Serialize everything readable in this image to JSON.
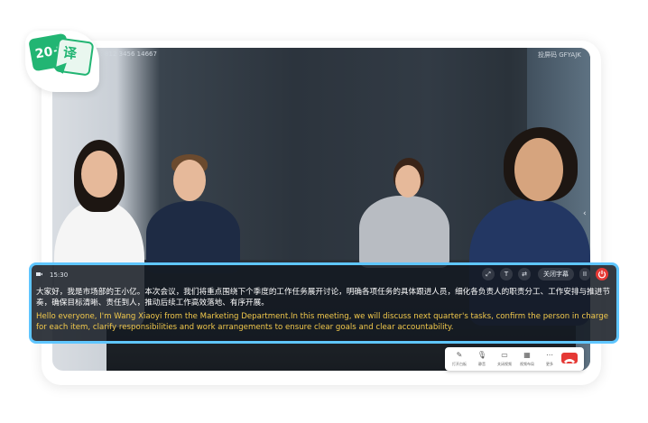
{
  "app": {
    "badge_count": "20+",
    "badge_char": "译",
    "badge_color": "#22b573"
  },
  "meeting": {
    "id_text": "ID: 812 3456 14667",
    "share_code_text": "投屏码 GFYAJK"
  },
  "caption_bar": {
    "time": "15:30",
    "close_subtitles_label": "关闭字幕",
    "pause_label": "II",
    "icons": [
      "expand-icon",
      "font-size-icon",
      "translate-icon",
      "pause-icon",
      "power-icon"
    ],
    "chinese_text": "大家好，我是市场部的王小亿。本次会议，我们将重点围绕下个季度的工作任务展开讨论，明确各项任务的具体跟进人员，细化各负责人的职责分工、工作安排与推进节奏，确保目标清晰、责任到人，推动后续工作高效落地、有序开展。",
    "english_text": "Hello everyone, I'm Wang Xiaoyi from the Marketing Department.In this meeting, we will discuss next quarter's tasks, confirm the person in charge for each item, clarify responsibilities and work arrangements to ensure clear goals and clear accountability.",
    "accent_color": "#5fc6ff",
    "english_color": "#f2c94c"
  },
  "toolbar": {
    "items": [
      {
        "label": "打开白板",
        "icon": "whiteboard-icon",
        "glyph": "✎"
      },
      {
        "label": "静音",
        "icon": "microphone-icon",
        "glyph": "🎙"
      },
      {
        "label": "关闭视频",
        "icon": "video-icon",
        "glyph": "▭"
      },
      {
        "label": "视频布局",
        "icon": "layout-icon",
        "glyph": "▦"
      },
      {
        "label": "更多",
        "icon": "more-icon",
        "glyph": "⋯"
      }
    ],
    "hangup_icon": "hangup-icon",
    "hangup_color": "#e53935"
  }
}
